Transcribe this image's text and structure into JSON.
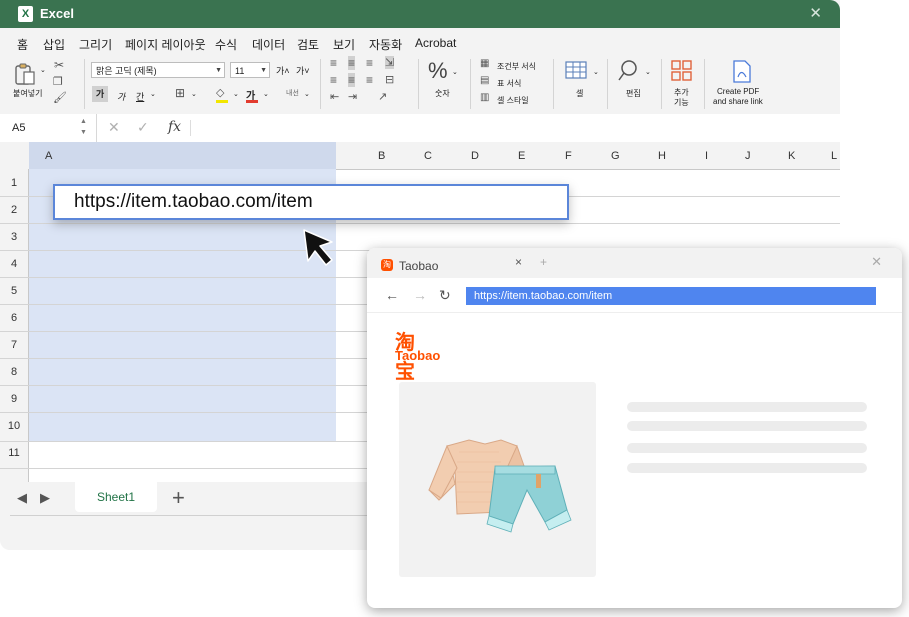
{
  "excel": {
    "title": "Excel",
    "menu": [
      "홈",
      "삽입",
      "그리기",
      "페이지 레이아웃",
      "수식",
      "데이터",
      "검토",
      "보기",
      "자동화",
      "Acrobat"
    ],
    "ribbon": {
      "paste_label": "붙여넣기",
      "font_name": "맑은 고딕 (제목)",
      "font_size": "11",
      "bold": "가",
      "italic": "가",
      "underline": "간",
      "wrap_label": "내선",
      "number_label": "숫자",
      "conditional_format": "조건부 서식",
      "table_format": "표 서식",
      "cell_styles": "셀 스타일",
      "cells_label": "셀",
      "editing_label": "편집",
      "addins_label_1": "추가",
      "addins_label_2": "기능",
      "pdf_label_1": "Create PDF",
      "pdf_label_2": "and share link"
    },
    "name_box": "A5",
    "fx": "fx",
    "columns": [
      "A",
      "B",
      "C",
      "D",
      "E",
      "F",
      "G",
      "H",
      "I",
      "J",
      "K",
      "L"
    ],
    "rows": [
      "1",
      "2",
      "3",
      "4",
      "5",
      "6",
      "7",
      "8",
      "9",
      "10",
      "11"
    ],
    "url_value": "https://item.taobao.com/item",
    "sheet_tab": "Sheet1"
  },
  "browser": {
    "tab_title": "Taobao",
    "tab_favicon": "淘",
    "address": "https://item.taobao.com/item",
    "logo_cn": "淘宝",
    "logo_en": "Taobao"
  },
  "colors": {
    "excel_green": "#3a7350",
    "selected_column": "#dbe4f5",
    "url_border": "#5b86d9",
    "taobao_orange": "#ff5000",
    "address_highlight": "#4f85ef"
  }
}
